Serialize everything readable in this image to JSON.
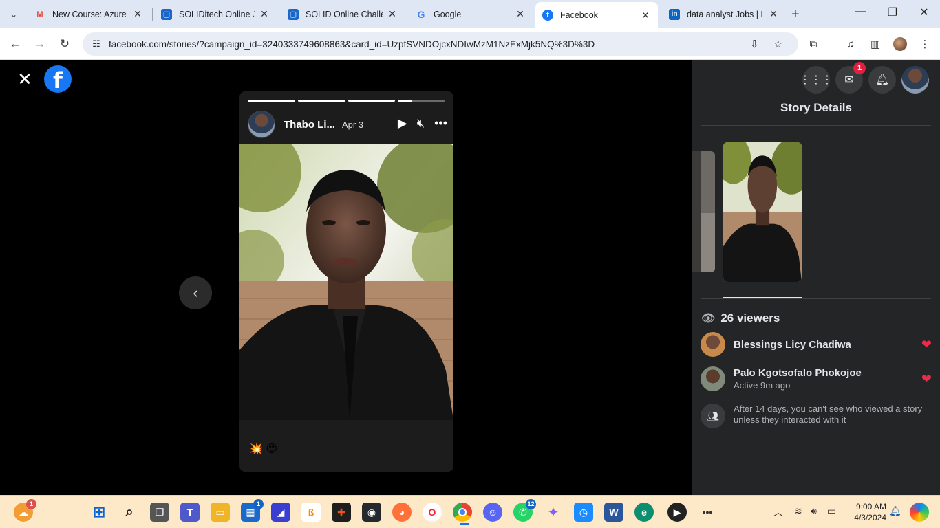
{
  "browser": {
    "tabs": [
      {
        "title": "New Course: Azure M",
        "icon": "gmail-icon"
      },
      {
        "title": "SOLIDitech Online JA",
        "icon": "doc-icon"
      },
      {
        "title": "SOLID Online Challen",
        "icon": "doc-icon"
      },
      {
        "title": "Google",
        "icon": "google-icon"
      },
      {
        "title": "Facebook",
        "icon": "facebook-icon",
        "active": true
      },
      {
        "title": "data analyst Jobs | Lin",
        "icon": "linkedin-icon"
      }
    ],
    "url": "facebook.com/stories/?campaign_id=3240333749608863&card_id=UzpfSVNDOjcxNDIwMzM1NzExMjk5NQ%3D%3D"
  },
  "story": {
    "author": "Thabo Li...",
    "date": "Apr 3",
    "caption": "💥 😍",
    "progress": [
      1,
      1,
      1,
      0.3
    ]
  },
  "panel": {
    "title": "Story Details",
    "messenger_badge": "1",
    "viewers_count": "26 viewers",
    "viewers": [
      {
        "name": "Blessings Licy Chadiwa",
        "sub": "",
        "reaction": "heart"
      },
      {
        "name": "Palo Kgotsofalo Phokojoe",
        "sub": "Active 9m ago",
        "reaction": "heart"
      }
    ],
    "note": "After 14 days, you can't see who viewed a story unless they interacted with it"
  },
  "taskbar": {
    "weather_badge": "1",
    "store_badge": "1",
    "whatsapp_badge": "12",
    "time": "9:00 AM",
    "date": "4/3/2024"
  },
  "colors": {
    "facebook_blue": "#1877f2",
    "panel_bg": "#242526",
    "heart": "#f02849"
  }
}
